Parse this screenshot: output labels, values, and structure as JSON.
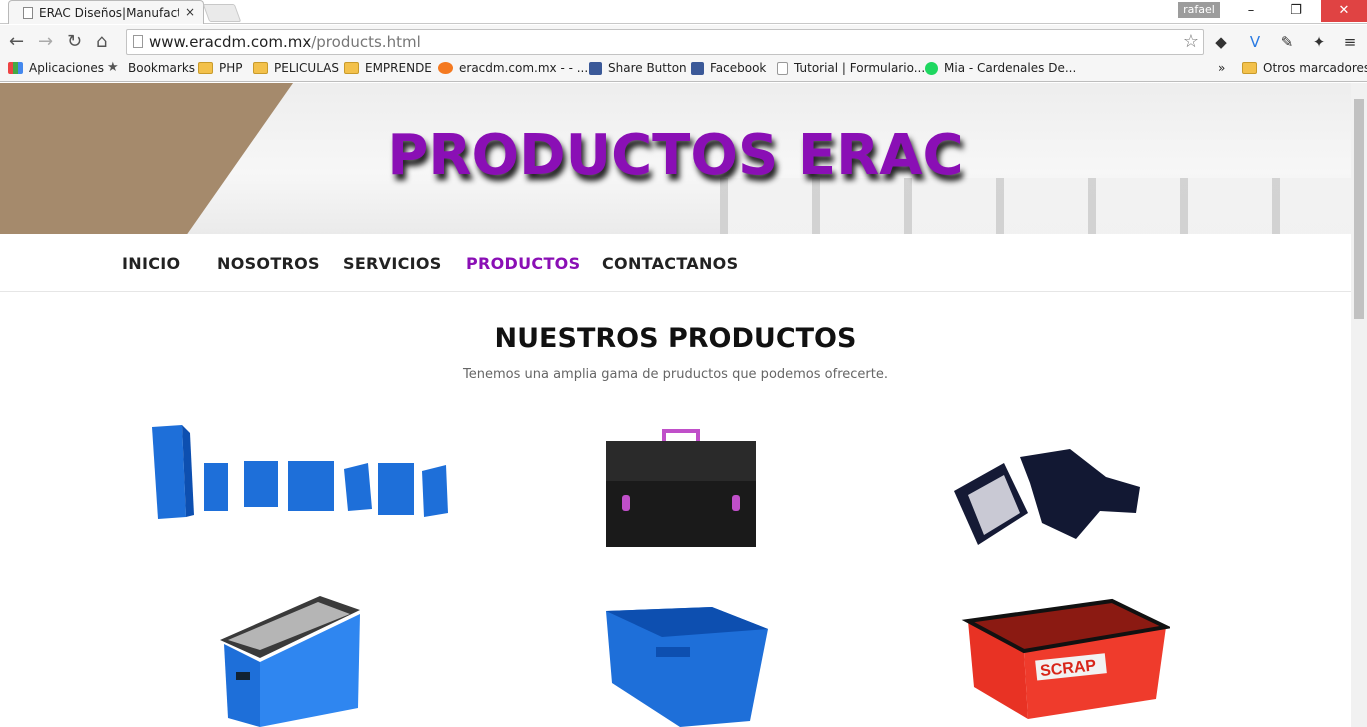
{
  "browser": {
    "tab_title": "ERAC Diseños|Manufactur",
    "tab_close": "×",
    "user": "rafael",
    "window_buttons": {
      "minimize": "–",
      "restore": "❐",
      "close": "✕"
    },
    "url_host": "www.eracdm.com.mx",
    "url_path": "/products.html",
    "nav": {
      "back": "←",
      "forward": "→",
      "reload": "↻",
      "home": "⌂"
    },
    "bookmarks": [
      {
        "label": "Aplicaciones",
        "icon": "apps-grid-icon"
      },
      {
        "label": "Bookmarks",
        "icon": "star-icon"
      },
      {
        "label": "PHP",
        "icon": "folder-icon"
      },
      {
        "label": "PELICULAS",
        "icon": "folder-icon"
      },
      {
        "label": "EMPRENDE",
        "icon": "folder-icon"
      },
      {
        "label": "eracdm.com.mx - - ...",
        "icon": "cpanel-icon"
      },
      {
        "label": "Share Button",
        "icon": "facebook-icon"
      },
      {
        "label": "Facebook",
        "icon": "facebook-icon"
      },
      {
        "label": "Tutorial | Formulario...",
        "icon": "page-icon"
      },
      {
        "label": "Mia - Cardenales De...",
        "icon": "spotify-icon"
      }
    ],
    "more_bookmarks": "»",
    "other_bookmarks": "Otros marcadores"
  },
  "banner": {
    "title": "PRODUCTOS ERAC"
  },
  "menu": [
    "INICIO",
    "NOSOTROS",
    "SERVICIOS",
    "PRODUCTOS",
    "CONTACTANOS"
  ],
  "menu_active": "PRODUCTOS",
  "section": {
    "title": "NUESTROS PRODUCTOS",
    "subtitle": "Tenemos una amplia gama de pruductos que podemos ofrecerte."
  },
  "products": [
    {
      "name": "blue-bins-product"
    },
    {
      "name": "black-briefcase-product"
    },
    {
      "name": "black-foldable-case-product"
    },
    {
      "name": "blue-divider-box-product"
    },
    {
      "name": "blue-tote-product"
    },
    {
      "name": "red-scrap-bin-product"
    }
  ],
  "colors": {
    "accent": "#8a0fb5",
    "banner_brown": "#a58a6c",
    "product_blue": "#1e6fd9",
    "product_red": "#ef3b2c"
  },
  "scrap_label": "SCRAP"
}
